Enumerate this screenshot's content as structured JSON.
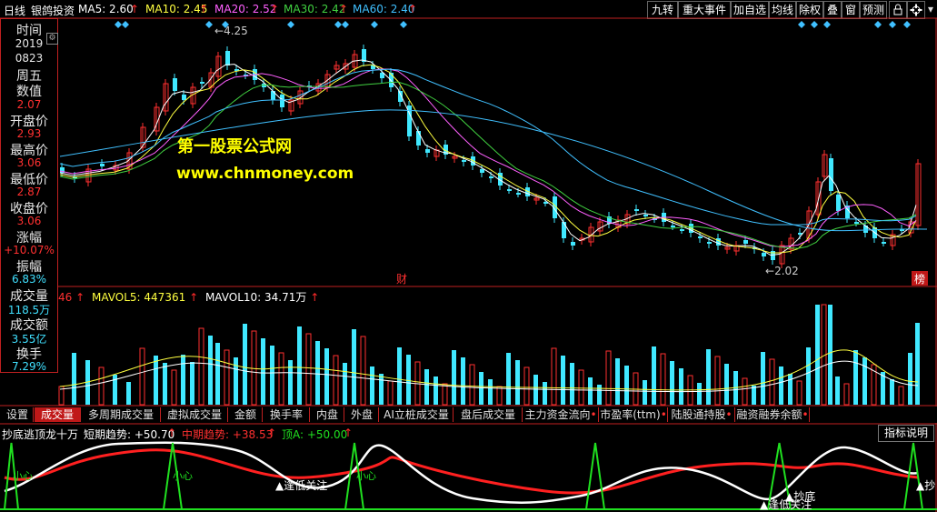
{
  "topbar": {
    "period": "日线",
    "stock": "银鸽投资",
    "ma5": "MA5: 2.60",
    "ma10": "MA10: 2.45",
    "ma20": "MA20: 2.52",
    "ma30": "MA30: 2.42",
    "ma60": "MA60: 2.40",
    "up": "↑",
    "buttons": [
      "九转",
      "重大事件",
      "加自选",
      "均线",
      "除权",
      "叠",
      "窗",
      "预测"
    ]
  },
  "info": {
    "time_label": "时间",
    "year": "2019",
    "date": "0823",
    "weekday": "周五",
    "value_label": "数值",
    "value": "2.07",
    "open_label": "开盘价",
    "open": "2.93",
    "high_label": "最高价",
    "high": "3.06",
    "low_label": "最低价",
    "low": "2.87",
    "close_label": "收盘价",
    "close": "3.06",
    "chg_label": "涨幅",
    "chg": "+10.07%",
    "amp_label": "振幅",
    "amp": "6.83%",
    "vol_label": "成交量",
    "vol": "118.5万",
    "amt_label": "成交额",
    "amt": "3.55亿",
    "turn_label": "换手",
    "turn": "7.29%"
  },
  "price_chart": {
    "high_mark": "4.25",
    "low_mark": "2.02",
    "watermark_title": "第一股票公式网",
    "watermark_url": "www.chnmoney.com",
    "tag_cai": "财",
    "tag_bang": "榜"
  },
  "volume": {
    "vol_val": "46",
    "mavol5": "MAVOL5: 447361",
    "mavol10": "MAVOL10: 34.71万"
  },
  "tabs": [
    "设置",
    "成交量",
    "多周期成交量",
    "虚拟成交量",
    "金额",
    "换手率",
    "内盘",
    "外盘",
    "AI立桩成交量",
    "盘后成交量",
    "主力资金流向",
    "市盈率(ttm)",
    "陆股通持股",
    "融资融券余额"
  ],
  "indicator": {
    "name": "抄底逃顶龙十万",
    "short": "短期趋势: +50.70",
    "mid": "中期趋势: +38.53",
    "top": "顶A: +50.00",
    "explain": "指标说明",
    "labels": [
      "小心",
      "小心",
      "小心",
      "逢低关注",
      "逢低关注",
      "抄底",
      "抄"
    ]
  },
  "chart_data": {
    "type": "candlestick",
    "y_marks": {
      "high": 4.25,
      "low": 2.02
    },
    "last_bar": {
      "open": 2.93,
      "high": 3.06,
      "low": 2.87,
      "close": 3.06
    },
    "series": [
      {
        "name": "MA5",
        "value": 2.6,
        "color": "#ffffff"
      },
      {
        "name": "MA10",
        "value": 2.45,
        "color": "#ffff40"
      },
      {
        "name": "MA20",
        "value": 2.52,
        "color": "#ff60ff"
      },
      {
        "name": "MA30",
        "value": 2.42,
        "color": "#40d040"
      },
      {
        "name": "MA60",
        "value": 2.4,
        "color": "#40c0ff"
      }
    ]
  },
  "colors": {
    "up": "#ff3030",
    "down": "#40e8ff",
    "border": "#c02020"
  }
}
